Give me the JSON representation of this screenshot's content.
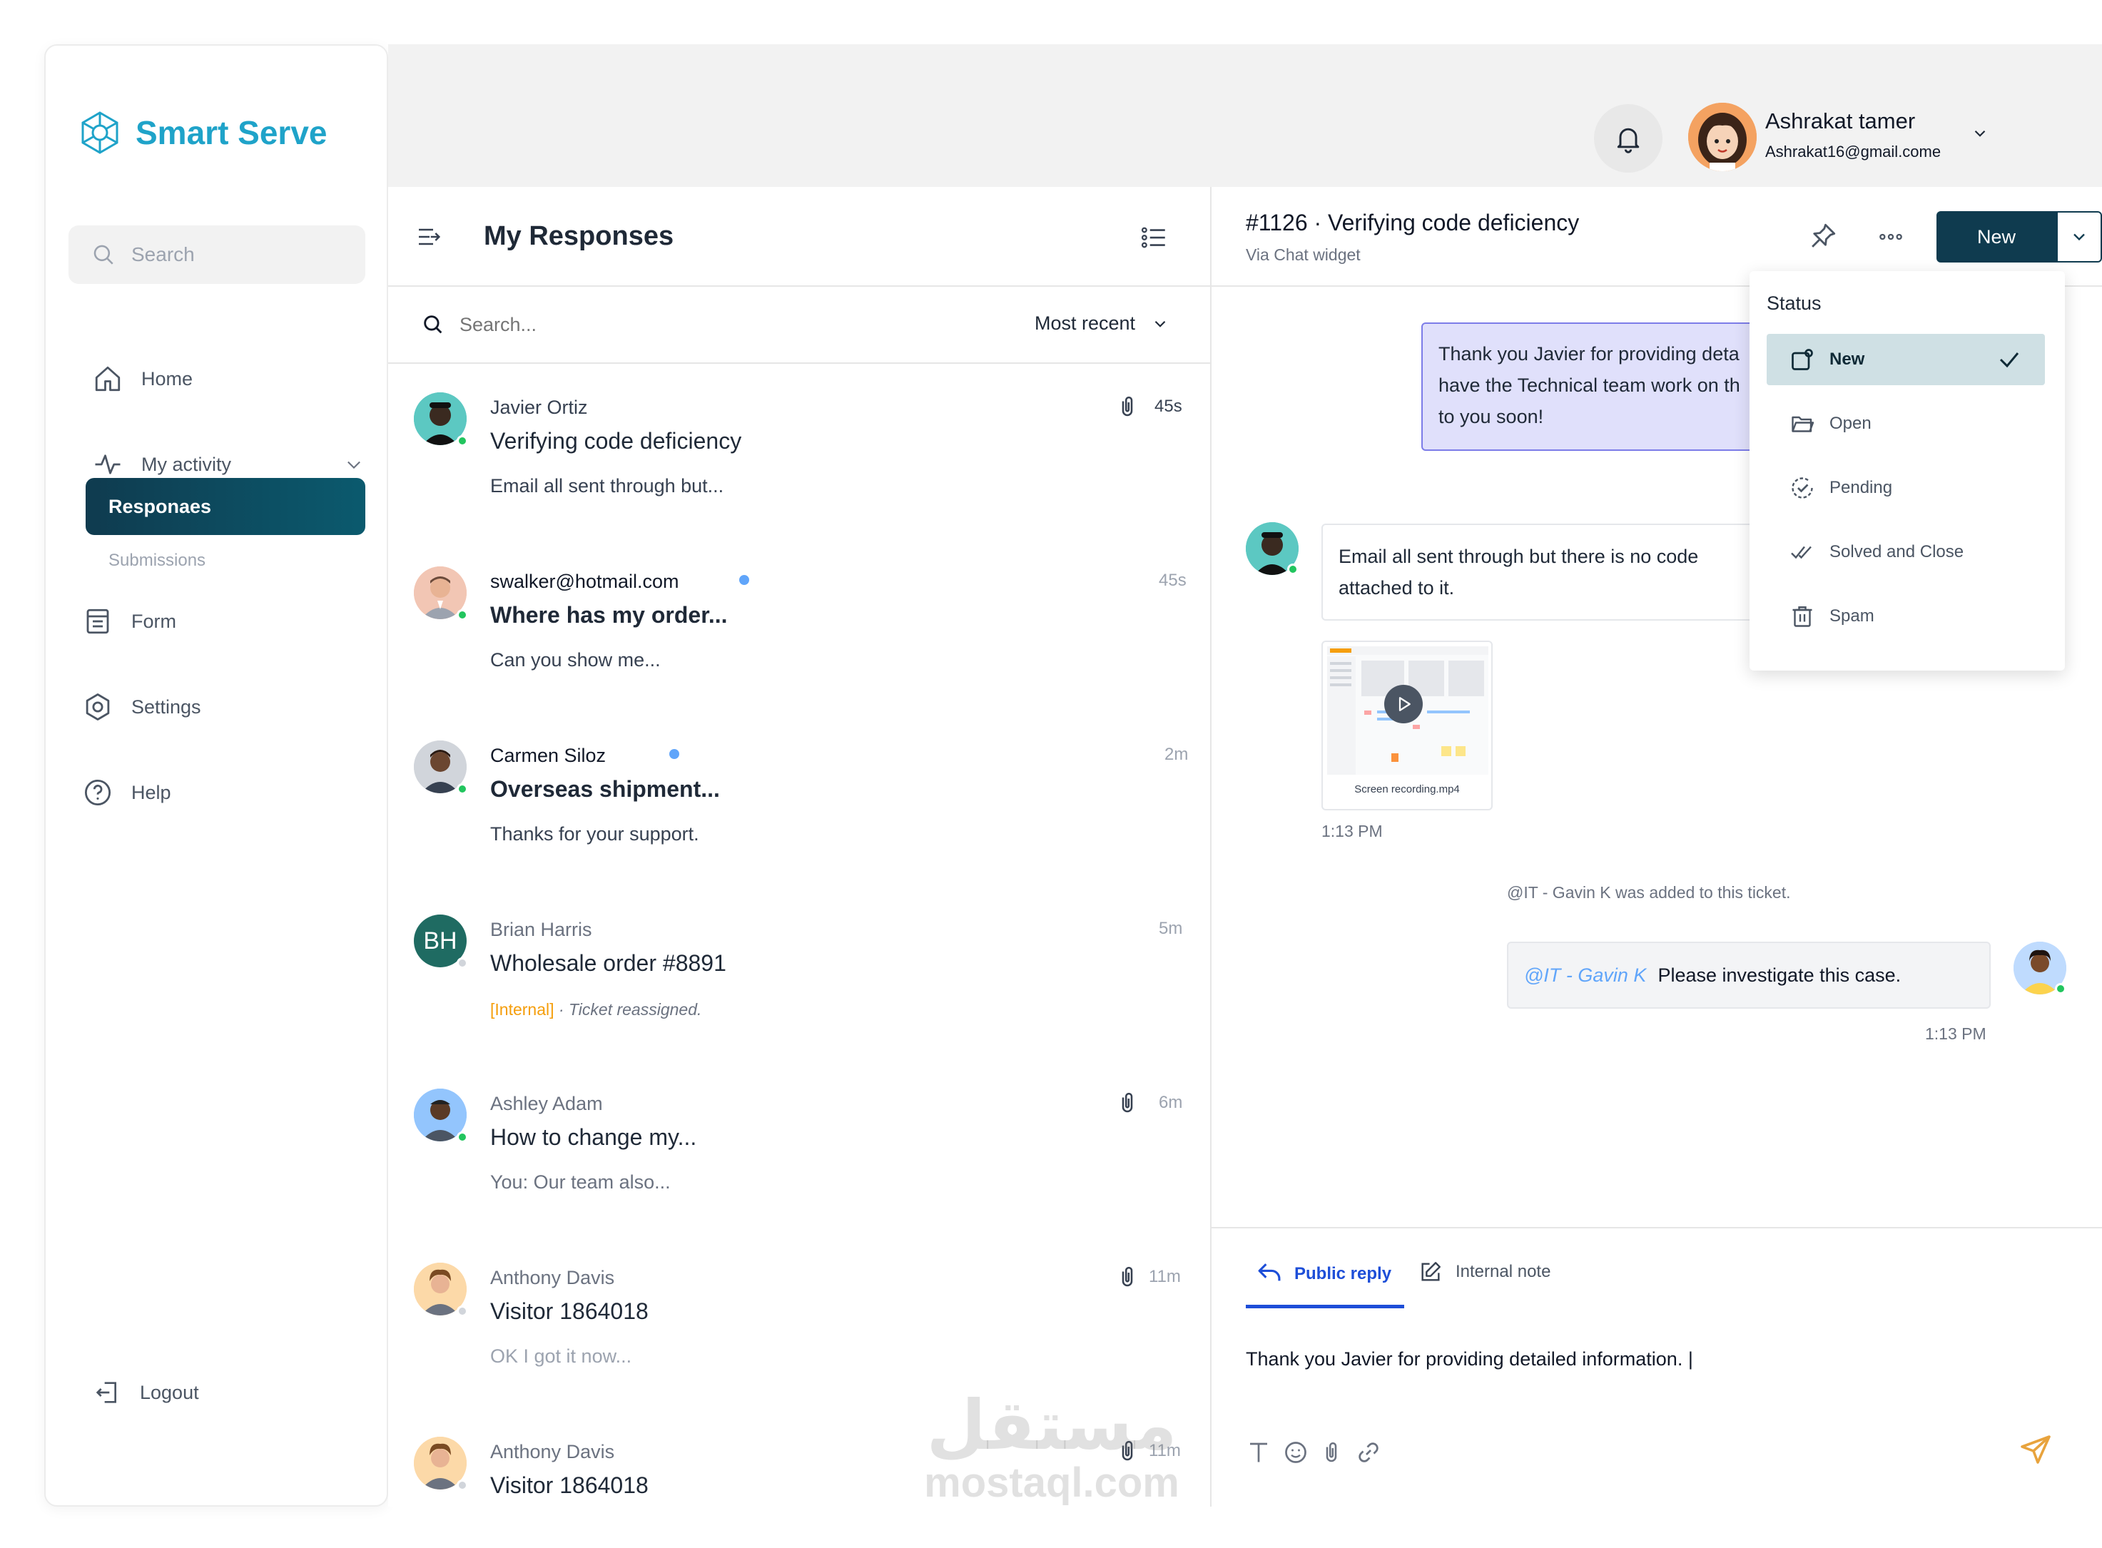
{
  "brand": {
    "name": "Smart Serve",
    "color": "#1fa3c9"
  },
  "sidebar": {
    "search_placeholder": "Search",
    "items": [
      {
        "label": "Home",
        "icon": "home-icon"
      },
      {
        "label": "My activity",
        "icon": "activity-icon"
      },
      {
        "label": "Responaes",
        "active": true
      },
      {
        "label": "Submissions"
      },
      {
        "label": "Form",
        "icon": "form-icon"
      },
      {
        "label": "Settings",
        "icon": "settings-icon"
      },
      {
        "label": "Help",
        "icon": "help-icon"
      }
    ],
    "logout_label": "Logout"
  },
  "user": {
    "name": "Ashrakat tamer",
    "email": "Ashrakat16@gmail.come"
  },
  "list": {
    "title": "My Responses",
    "search_placeholder": "Search...",
    "sort_label": "Most recent",
    "items": [
      {
        "sender": "Javier Ortiz",
        "subject": "Verifying code deficiency",
        "preview": "Email all sent through but...",
        "time": "45s",
        "attachment": true,
        "unread": false
      },
      {
        "sender": "swalker@hotmail.com",
        "subject": "Where has my order...",
        "preview": "Can you show me...",
        "time": "45s",
        "attachment": false,
        "unread": true
      },
      {
        "sender": "Carmen Siloz",
        "subject": "Overseas shipment...",
        "preview": "Thanks for your support.",
        "time": "2m",
        "attachment": false,
        "unread": true
      },
      {
        "sender": "Brian Harris",
        "subject": "Wholesale order #8891",
        "preview_tag": "[Internal]",
        "preview": " · Ticket reassigned.",
        "time": "5m",
        "initials": "BH",
        "attachment": false,
        "unread": false
      },
      {
        "sender": "Ashley Adam",
        "subject": "How to change my...",
        "preview": "You: Our team also...",
        "time": "6m",
        "attachment": true,
        "unread": false
      },
      {
        "sender": "Anthony Davis",
        "subject": "Visitor 1864018",
        "preview": "OK I got it now...",
        "time": "11m",
        "attachment": true,
        "unread": false
      },
      {
        "sender": "Anthony Davis",
        "subject": "Visitor 1864018",
        "preview": "",
        "time": "11m",
        "attachment": true,
        "unread": false
      }
    ]
  },
  "ticket": {
    "title": "#1126 · Verifying code deficiency",
    "source": "Via Chat widget",
    "status_button": "New"
  },
  "status_menu": {
    "heading": "Status",
    "options": [
      {
        "label": "New",
        "icon": "new-icon",
        "selected": true
      },
      {
        "label": "Open",
        "icon": "folder-icon"
      },
      {
        "label": "Pending",
        "icon": "pending-icon"
      },
      {
        "label": "Solved and Close",
        "icon": "double-check-icon"
      },
      {
        "label": "Spam",
        "icon": "trash-icon"
      }
    ]
  },
  "chat": {
    "agent_message": [
      "Thank you Javier for providing deta",
      "have the Technical team work on th",
      "to you soon!"
    ],
    "customer_message": [
      "Email all sent through but there is no code",
      "attached to it."
    ],
    "attachment_name": "Screen recording.mp4",
    "time_1": "1:13 PM",
    "system_note_mention": "@IT - Gavin K",
    "system_note_text": " was added to this ticket.",
    "internal_mention": "@IT - Gavin K",
    "internal_text": "Please investigate this case.",
    "time_2": "1:13 PM"
  },
  "composer": {
    "tab_public": "Public reply",
    "tab_internal": "Internal note",
    "draft": "Thank you Javier for providing detailed information. |"
  },
  "watermark": {
    "arabic": "مستقل",
    "latin": "mostaql.com"
  },
  "colors": {
    "accent_dark": "#0f3b4f",
    "link_blue": "#1d4ed8",
    "internal_orange": "#f59e0b",
    "bubble_agent": "#e0e0fb",
    "send_icon": "#e8a33d"
  }
}
